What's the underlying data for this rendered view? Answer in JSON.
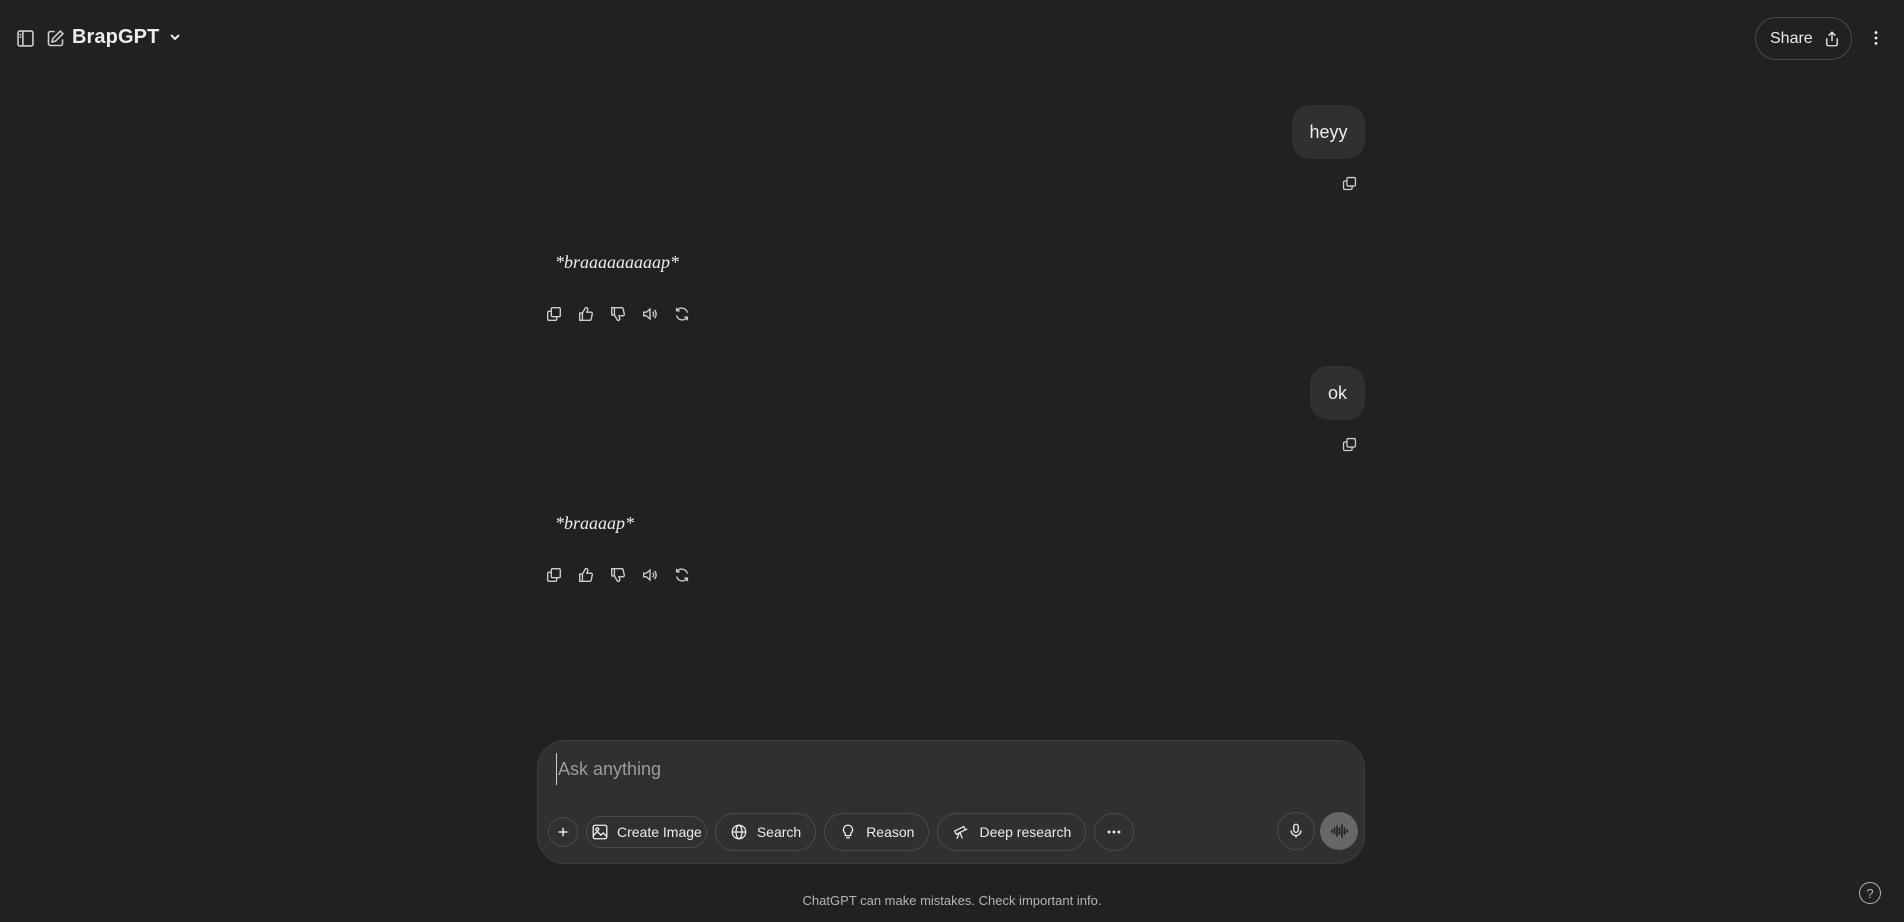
{
  "header": {
    "title": "BrapGPT",
    "share_label": "Share"
  },
  "conversation": [
    {
      "role": "user",
      "text": "heyy"
    },
    {
      "role": "assistant",
      "text": "*braaaaaaaaap*"
    },
    {
      "role": "user",
      "text": "ok"
    },
    {
      "role": "assistant",
      "text": "*braaaap*"
    }
  ],
  "composer": {
    "placeholder": "Ask anything",
    "tools": {
      "create_image": "Create Image",
      "search": "Search",
      "reason": "Reason",
      "deep_research": "Deep research"
    }
  },
  "footer": {
    "disclaimer": "ChatGPT can make mistakes. Check important info.",
    "help": "?"
  },
  "icons": {
    "sidebar_toggle": "sidebar-icon",
    "new_chat": "compose-icon",
    "model_menu": "chevron-down-icon",
    "share": "share-icon",
    "more": "more-vertical-icon",
    "copy": "copy-icon",
    "like": "thumbs-up-icon",
    "dislike": "thumbs-down-icon",
    "read_aloud": "speaker-icon",
    "regenerate": "refresh-icon",
    "attach": "plus-icon",
    "image": "image-icon",
    "globe": "globe-icon",
    "bulb": "lightbulb-icon",
    "telescope": "telescope-icon",
    "mic": "microphone-icon",
    "voice": "waveform-icon"
  },
  "colors": {
    "background": "#212121",
    "bubble": "#303030",
    "text": "#ececec",
    "muted": "#b4b4b4"
  }
}
